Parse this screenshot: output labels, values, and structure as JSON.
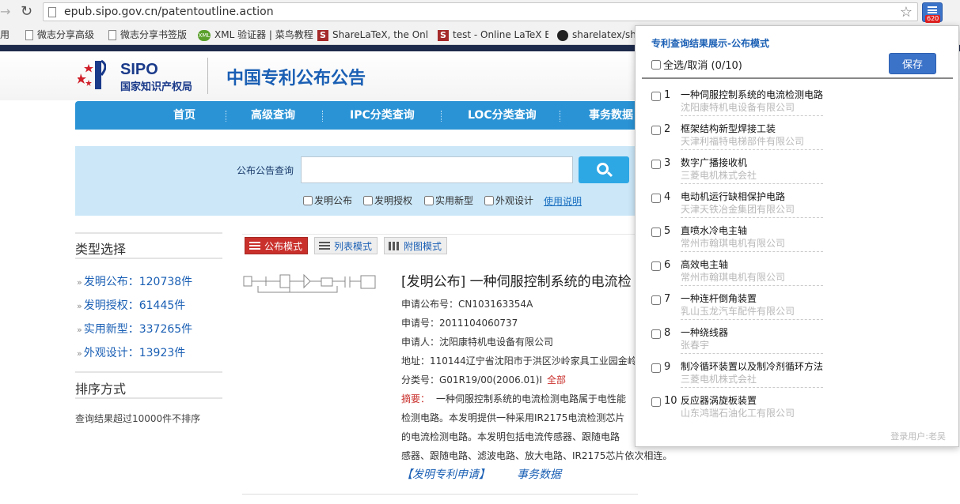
{
  "browser": {
    "url": "epub.sipo.gov.cn/patentoutline.action",
    "bookmarks": [
      {
        "label": "用",
        "icon": "none"
      },
      {
        "label": "微志分享高级",
        "icon": "page-icon"
      },
      {
        "label": "微志分享书签版",
        "icon": "page-icon"
      },
      {
        "label": "XML 验证器 | 菜鸟教程",
        "icon": "xml-icon"
      },
      {
        "label": "ShareLaTeX, the Onli",
        "icon": "sharelatex-icon"
      },
      {
        "label": "test - Online LaTeX E",
        "icon": "sharelatex-icon"
      },
      {
        "label": "sharelatex/sha",
        "icon": "github-icon"
      }
    ],
    "extension_badge": "620",
    "accent": "#3b73c9"
  },
  "header": {
    "logo_text": "SIPO",
    "logo_subtitle": "国家知识产权局",
    "site_title": "中国专利公布公告"
  },
  "nav": {
    "items": [
      "首页",
      "高级查询",
      "IPC分类查询",
      "LOC分类查询",
      "事务数据"
    ],
    "color": "#2a93d5"
  },
  "search": {
    "label": "公布公告查询",
    "value": "",
    "types": [
      "发明公布",
      "发明授权",
      "实用新型",
      "外观设计"
    ],
    "help_link": "使用说明"
  },
  "sidebar": {
    "type_title": "类型选择",
    "types": [
      {
        "label": "发明公布：120738件"
      },
      {
        "label": "发明授权：61445件"
      },
      {
        "label": "实用新型：337265件"
      },
      {
        "label": "外观设计：13923件"
      }
    ],
    "sort_title": "排序方式",
    "sort_note": "查询结果超过10000件不排序"
  },
  "modes": {
    "announce": "公布模式",
    "list": "列表模式",
    "figure": "附图模式"
  },
  "result": {
    "title": "[发明公布] 一种伺服控制系统的电流检",
    "pub_no": "申请公布号：CN103163354A",
    "app_no": "申请号：2011104060737",
    "applicant": "申请人：沈阳康特机电设备有限公司",
    "address": "地址：110144辽宁省沈阳市于洪区沙岭家具工业园金岭",
    "class_no": "分类号：G01R19/00(2006.01)I",
    "class_more": "全部",
    "abstract_label": "摘要：",
    "abstract_lines": [
      "一种伺服控制系统的电流检测电路属于电性能",
      "检测电路。本发明提供一种采用IR2175电流检测芯片",
      "的电流检测电路。本发明包括电流传感器、跟随电路",
      "感器、跟随电路、滤波电路、放大电路、IR2175芯片依次相连。"
    ],
    "apply_link": "【发明专利申请】",
    "status_link": "事务数据"
  },
  "popup": {
    "title": "专利查询结果展示-公布模式",
    "select_all": "全选/取消 (0/10)",
    "save": "保存",
    "items": [
      {
        "num": "1",
        "name": "一种伺服控制系统的电流检测电路",
        "assignee": "沈阳康特机电设备有限公司"
      },
      {
        "num": "2",
        "name": "框架结构新型焊接工装",
        "assignee": "天津利福特电梯部件有限公司"
      },
      {
        "num": "3",
        "name": "数字广播接收机",
        "assignee": "三菱电机株式会社"
      },
      {
        "num": "4",
        "name": "电动机运行缺相保护电路",
        "assignee": "天津天铁冶金集团有限公司"
      },
      {
        "num": "5",
        "name": "直喷水冷电主轴",
        "assignee": "常州市翰琪电机有限公司"
      },
      {
        "num": "6",
        "name": "高效电主轴",
        "assignee": "常州市翰琪电机有限公司"
      },
      {
        "num": "7",
        "name": "一种连杆倒角装置",
        "assignee": "乳山玉龙汽车配件有限公司"
      },
      {
        "num": "8",
        "name": "一种绕线器",
        "assignee": "张春宇"
      },
      {
        "num": "9",
        "name": "制冷循环装置以及制冷剂循环方法",
        "assignee": "三菱电机株式会社"
      },
      {
        "num": "10",
        "name": "反应器涡旋板装置",
        "assignee": "山东鸿瑞石油化工有限公司"
      }
    ],
    "login_user": "登录用户:老吴"
  }
}
